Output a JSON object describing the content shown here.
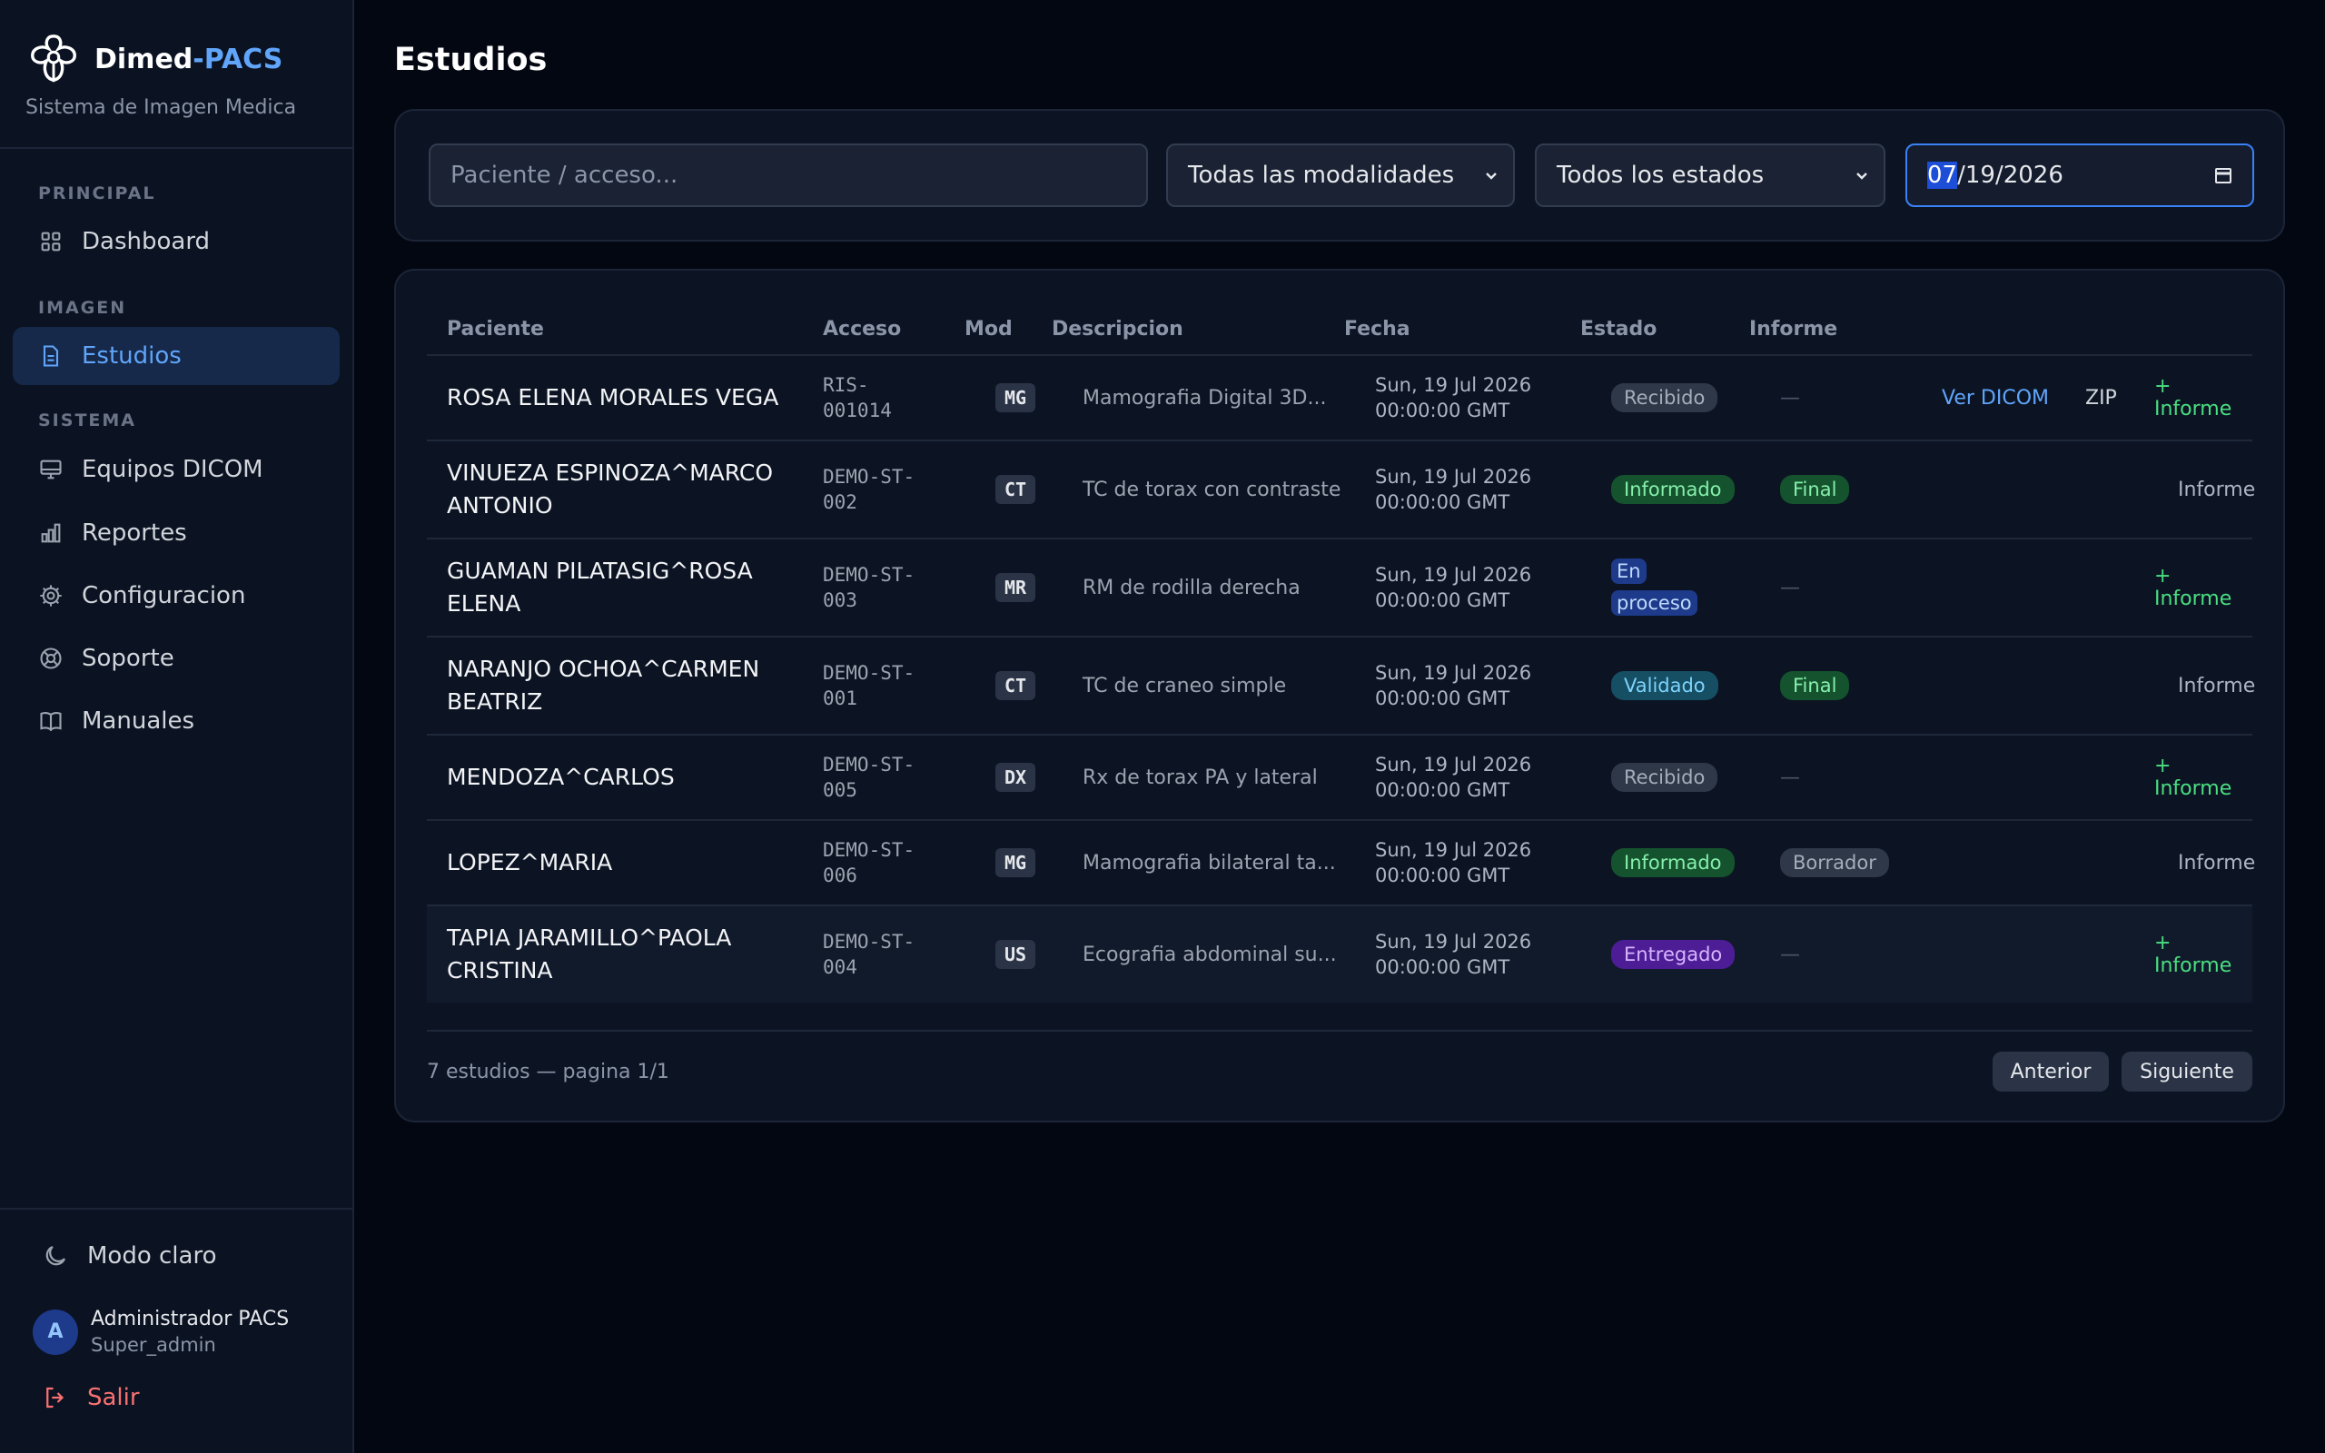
{
  "brand": {
    "name": "Dimed",
    "accent": "-PACS",
    "subtitle": "Sistema de Imagen Medica"
  },
  "sidebar": {
    "sections": {
      "principal": "PRINCIPAL",
      "imagen": "IMAGEN",
      "sistema": "SISTEMA"
    },
    "items": [
      {
        "label": "Dashboard",
        "icon": "grid-icon"
      },
      {
        "label": "Estudios",
        "icon": "document-icon",
        "active": true
      },
      {
        "label": "Equipos DICOM",
        "icon": "monitor-icon"
      },
      {
        "label": "Reportes",
        "icon": "bar-chart-icon"
      },
      {
        "label": "Configuracion",
        "icon": "gear-icon"
      },
      {
        "label": "Soporte",
        "icon": "lifebuoy-icon"
      },
      {
        "label": "Manuales",
        "icon": "book-icon"
      }
    ],
    "theme_toggle": "Modo claro",
    "user": {
      "initial": "A",
      "name": "Administrador PACS",
      "role": "Super_admin"
    },
    "logout": "Salir"
  },
  "main": {
    "title": "Estudios",
    "filters": {
      "search_placeholder": "Paciente / acceso...",
      "modality": "Todas las modalidades",
      "status": "Todos los estados",
      "date_month": "07",
      "date_rest": "/19/2026"
    },
    "table": {
      "columns": [
        "Paciente",
        "Acceso",
        "Mod",
        "Descripcion",
        "Fecha",
        "Estado",
        "Informe"
      ],
      "rows": [
        {
          "patient": "ROSA ELENA MORALES VEGA",
          "acc1": "RIS-",
          "acc2": "001014",
          "mod": "MG",
          "desc": "Mamografia Digital 3D...",
          "date1": "Sun, 19 Jul 2026",
          "date2": "00:00:00 GMT",
          "state": "Recibido",
          "report": "—",
          "actions": [
            "Ver DICOM",
            "ZIP",
            "+ Informe"
          ]
        },
        {
          "patient1": "VINUEZA ESPINOZA^MARCO",
          "patient2": "ANTONIO",
          "acc1": "DEMO-ST-",
          "acc2": "002",
          "mod": "CT",
          "desc": "TC de torax con contraste",
          "date1": "Sun, 19 Jul 2026",
          "date2": "00:00:00 GMT",
          "state": "Informado",
          "report": "Final",
          "action": "Informe"
        },
        {
          "patient1": "GUAMAN PILATASIG^ROSA",
          "patient2": "ELENA",
          "acc1": "DEMO-ST-",
          "acc2": "003",
          "mod": "MR",
          "desc": "RM de rodilla derecha",
          "date1": "Sun, 19 Jul 2026",
          "date2": "00:00:00 GMT",
          "state1": "En",
          "state2": "proceso",
          "report": "—",
          "action": "+ Informe"
        },
        {
          "patient1": "NARANJO OCHOA^CARMEN",
          "patient2": "BEATRIZ",
          "acc1": "DEMO-ST-",
          "acc2": "001",
          "mod": "CT",
          "desc": "TC de craneo simple",
          "date1": "Sun, 19 Jul 2026",
          "date2": "00:00:00 GMT",
          "state": "Validado",
          "report": "Final",
          "action": "Informe"
        },
        {
          "patient": "MENDOZA^CARLOS",
          "acc1": "DEMO-ST-",
          "acc2": "005",
          "mod": "DX",
          "desc": "Rx de torax PA y lateral",
          "date1": "Sun, 19 Jul 2026",
          "date2": "00:00:00 GMT",
          "state": "Recibido",
          "report": "—",
          "action": "+ Informe"
        },
        {
          "patient": "LOPEZ^MARIA",
          "acc1": "DEMO-ST-",
          "acc2": "006",
          "mod": "MG",
          "desc": "Mamografia bilateral ta...",
          "date1": "Sun, 19 Jul 2026",
          "date2": "00:00:00 GMT",
          "state": "Informado",
          "report": "Borrador",
          "action": "Informe"
        },
        {
          "patient1": "TAPIA JARAMILLO^PAOLA",
          "patient2": "CRISTINA",
          "acc1": "DEMO-ST-",
          "acc2": "004",
          "mod": "US",
          "desc": "Ecografia abdominal su...",
          "date1": "Sun, 19 Jul 2026",
          "date2": "00:00:00 GMT",
          "state": "Entregado",
          "report": "—",
          "action": "+ Informe"
        }
      ]
    },
    "pagination": {
      "summary": "7 estudios — pagina 1/1",
      "prev": "Anterior",
      "next": "Siguiente"
    }
  },
  "colors": {
    "accent": "#60a5fa",
    "background": "#030712",
    "sidebar": "#0b1222",
    "success": "#4ade80",
    "danger": "#f87171"
  }
}
